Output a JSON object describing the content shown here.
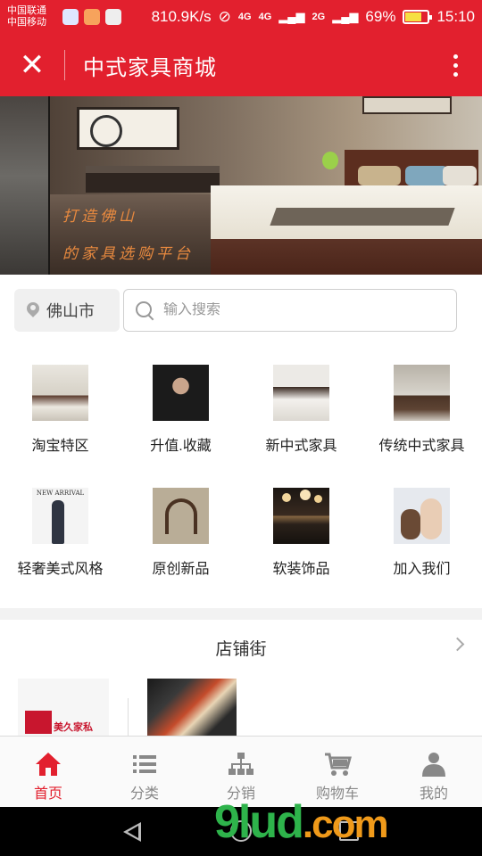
{
  "status_bar": {
    "carrier_1": "中国联通",
    "carrier_2": "中国移动",
    "speed": "810.9K/s",
    "net_1": "4G",
    "net_2": "4G",
    "net_3": "2G",
    "battery": "69%",
    "time": "15:10"
  },
  "header": {
    "title": "中式家具商城",
    "close_icon": "close-icon",
    "more_icon": "more-vertical-icon"
  },
  "banner": {
    "line_1": "打造佛山",
    "line_2": "的家具选购平台"
  },
  "search": {
    "city": "佛山市",
    "placeholder": "输入搜索",
    "location_icon": "location-pin-icon",
    "search_icon": "search-icon"
  },
  "categories": [
    {
      "label": "淘宝特区"
    },
    {
      "label": "升值.收藏"
    },
    {
      "label": "新中式家具"
    },
    {
      "label": "传统中式家具"
    },
    {
      "label": "轻奢美式风格"
    },
    {
      "label": "原创新品"
    },
    {
      "label": "软装饰品"
    },
    {
      "label": "加入我们"
    }
  ],
  "thumb_texts": {
    "new_arrival": "NEW ARRIVAL"
  },
  "shop_street": {
    "title": "店铺街",
    "shop_1_name": "美久家私"
  },
  "tabbar": {
    "tabs": [
      {
        "label": "首页",
        "icon": "home-icon",
        "active": true
      },
      {
        "label": "分类",
        "icon": "list-icon",
        "active": false
      },
      {
        "label": "分销",
        "icon": "hierarchy-icon",
        "active": false
      },
      {
        "label": "购物车",
        "icon": "cart-icon",
        "active": false
      },
      {
        "label": "我的",
        "icon": "user-icon",
        "active": false
      }
    ]
  },
  "watermark": {
    "main": "9lud",
    "suffix": ".com"
  },
  "colors": {
    "brand": "#e2202e",
    "tab_inactive": "#888888"
  }
}
